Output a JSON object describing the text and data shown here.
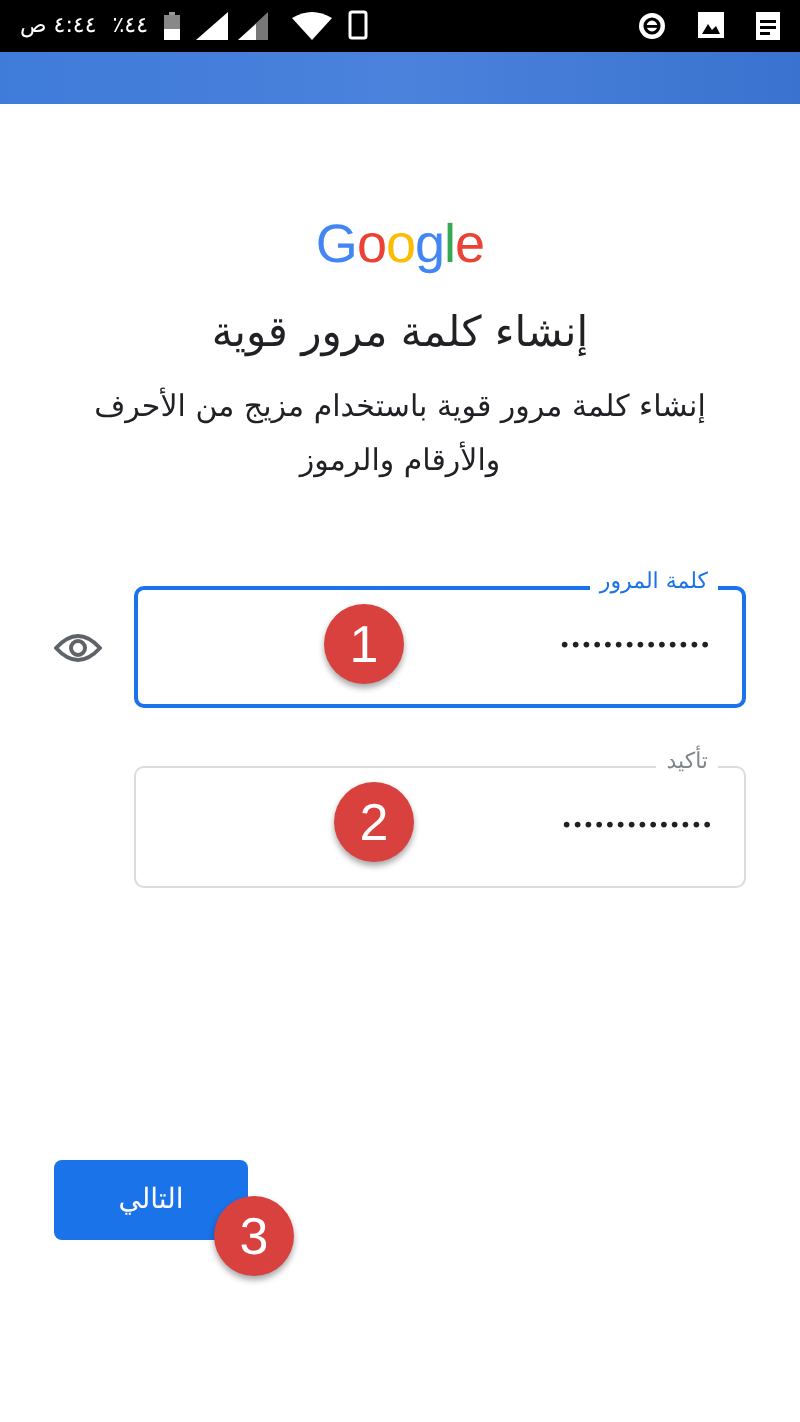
{
  "status_bar": {
    "time": "٤:٤٤ ص",
    "battery": "٪٤٤"
  },
  "logo": "Google",
  "title": "إنشاء كلمة مرور قوية",
  "subtitle": "إنشاء كلمة مرور قوية باستخدام مزيج من الأحرف والأرقام والرموز",
  "fields": [
    {
      "label": "كلمة المرور",
      "value": "••••••••••••••",
      "focused": true,
      "marker": "1"
    },
    {
      "label": "تأكيد",
      "value": "••••••••••••••",
      "focused": false,
      "marker": "2"
    }
  ],
  "next_button": {
    "label": "التالي",
    "marker": "3"
  }
}
